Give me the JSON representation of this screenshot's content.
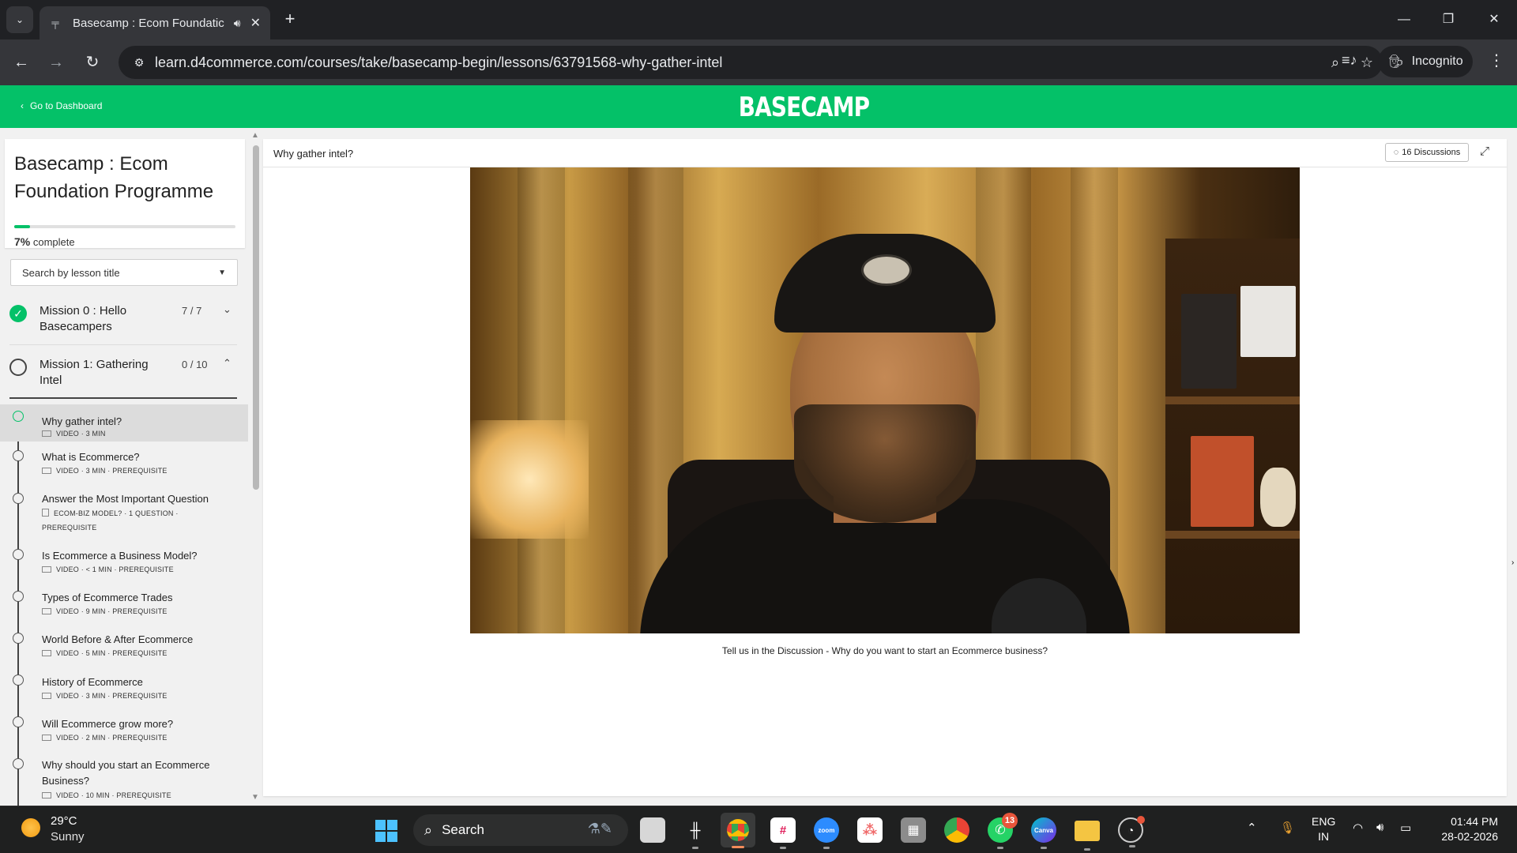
{
  "browser": {
    "tab_title": "Basecamp : Ecom Foundatic",
    "url": "learn.d4commerce.com/courses/take/basecamp-begin/lessons/63791568-why-gather-intel",
    "incognito_label": "Incognito"
  },
  "header": {
    "back_label": "Go to Dashboard",
    "brand": "BASECAMP"
  },
  "sidebar": {
    "course_title": "Basecamp : Ecom Foundation Programme",
    "progress_percent": 7,
    "progress_value": "7%",
    "progress_suffix": "complete",
    "search_placeholder": "Search by lesson title",
    "missions": [
      {
        "title": "Mission 0 : Hello Basecampers",
        "count": "7 / 7",
        "status": "complete"
      },
      {
        "title": "Mission 1: Gathering Intel",
        "count": "0 / 10",
        "status": "in-progress"
      }
    ],
    "lessons": [
      {
        "title": "Why gather intel?",
        "meta": "VIDEO · 3 MIN",
        "active": true
      },
      {
        "title": "What is Ecommerce?",
        "meta": "VIDEO · 3 MIN · PREREQUISITE"
      },
      {
        "title": "Answer the Most Important Question",
        "meta": "ECOM-BIZ MODEL? · 1 QUESTION ·",
        "meta2": "PREREQUISITE"
      },
      {
        "title": "Is Ecommerce a Business Model?",
        "meta": "VIDEO · < 1 MIN · PREREQUISITE"
      },
      {
        "title": "Types of Ecommerce Trades",
        "meta": "VIDEO · 9 MIN · PREREQUISITE"
      },
      {
        "title": "World Before & After Ecommerce",
        "meta": "VIDEO · 5 MIN · PREREQUISITE"
      },
      {
        "title": "History of Ecommerce",
        "meta": "VIDEO · 3 MIN · PREREQUISITE"
      },
      {
        "title": "Will Ecommerce grow more?",
        "meta": "VIDEO · 2 MIN · PREREQUISITE"
      },
      {
        "title": "Why should you start an Ecommerce",
        "title2": "Business?",
        "meta": "VIDEO · 10 MIN · PREREQUISITE"
      }
    ]
  },
  "main": {
    "lesson_title": "Why gather intel?",
    "discussions_label": "16 Discussions",
    "prompt": "Tell us in the Discussion - Why do you want to start an Ecommerce business?"
  },
  "taskbar": {
    "temperature": "29°C",
    "weather": "Sunny",
    "search_label": "Search",
    "whatsapp_badge": "13",
    "lang_1": "ENG",
    "lang_2": "IN",
    "time": "01:44 PM",
    "date": "28-02-2026"
  },
  "colors": {
    "brand_green": "#04c168",
    "chrome_dark": "#202124",
    "taskbar": "#1f2020"
  }
}
